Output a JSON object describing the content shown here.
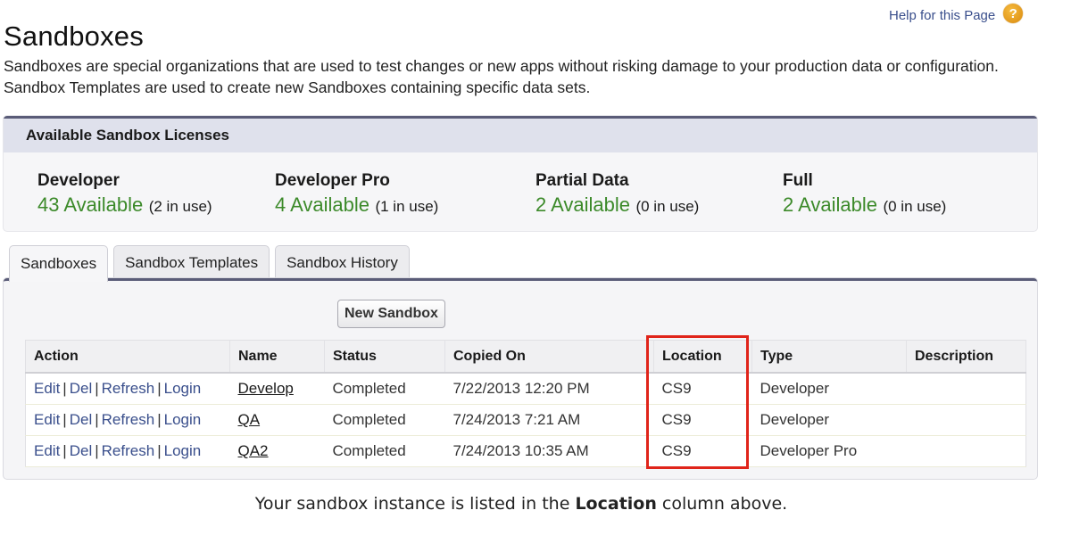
{
  "header": {
    "title": "Sandboxes",
    "help_label": "Help for this Page",
    "help_icon": "question-mark-icon"
  },
  "intro": "Sandboxes are special organizations that are used to test changes or new apps without risking damage to your production data or configuration. Sandbox Templates are used to create new Sandboxes containing specific data sets.",
  "licenses": {
    "title": "Available Sandbox Licenses",
    "items": [
      {
        "name": "Developer",
        "available": "43 Available",
        "in_use": "(2 in use)"
      },
      {
        "name": "Developer Pro",
        "available": "4 Available",
        "in_use": "(1 in use)"
      },
      {
        "name": "Partial Data",
        "available": "2 Available",
        "in_use": "(0 in use)"
      },
      {
        "name": "Full",
        "available": "2 Available",
        "in_use": "(0 in use)"
      }
    ],
    "available_color": "#3c8a2a"
  },
  "tabs": [
    {
      "label": "Sandboxes",
      "active": true
    },
    {
      "label": "Sandbox Templates",
      "active": false
    },
    {
      "label": "Sandbox History",
      "active": false
    }
  ],
  "panel": {
    "new_button_label": "New Sandbox",
    "columns": [
      "Action",
      "Name",
      "Status",
      "Copied On",
      "Location",
      "Type",
      "Description"
    ],
    "action_links": [
      "Edit",
      "Del",
      "Refresh",
      "Login"
    ],
    "action_separator": "|",
    "rows": [
      {
        "name": "Develop",
        "status": "Completed",
        "copied_on": "7/22/2013 12:20 PM",
        "location": "CS9",
        "type": "Developer",
        "description": ""
      },
      {
        "name": "QA",
        "status": "Completed",
        "copied_on": "7/24/2013 7:21 AM",
        "location": "CS9",
        "type": "Developer",
        "description": ""
      },
      {
        "name": "QA2",
        "status": "Completed",
        "copied_on": "7/24/2013 10:35 AM",
        "location": "CS9",
        "type": "Developer Pro",
        "description": ""
      }
    ],
    "highlight_color": "#e0241a"
  },
  "caption": {
    "before": "Your sandbox instance is listed in the ",
    "bold": "Location",
    "after": " column above."
  }
}
